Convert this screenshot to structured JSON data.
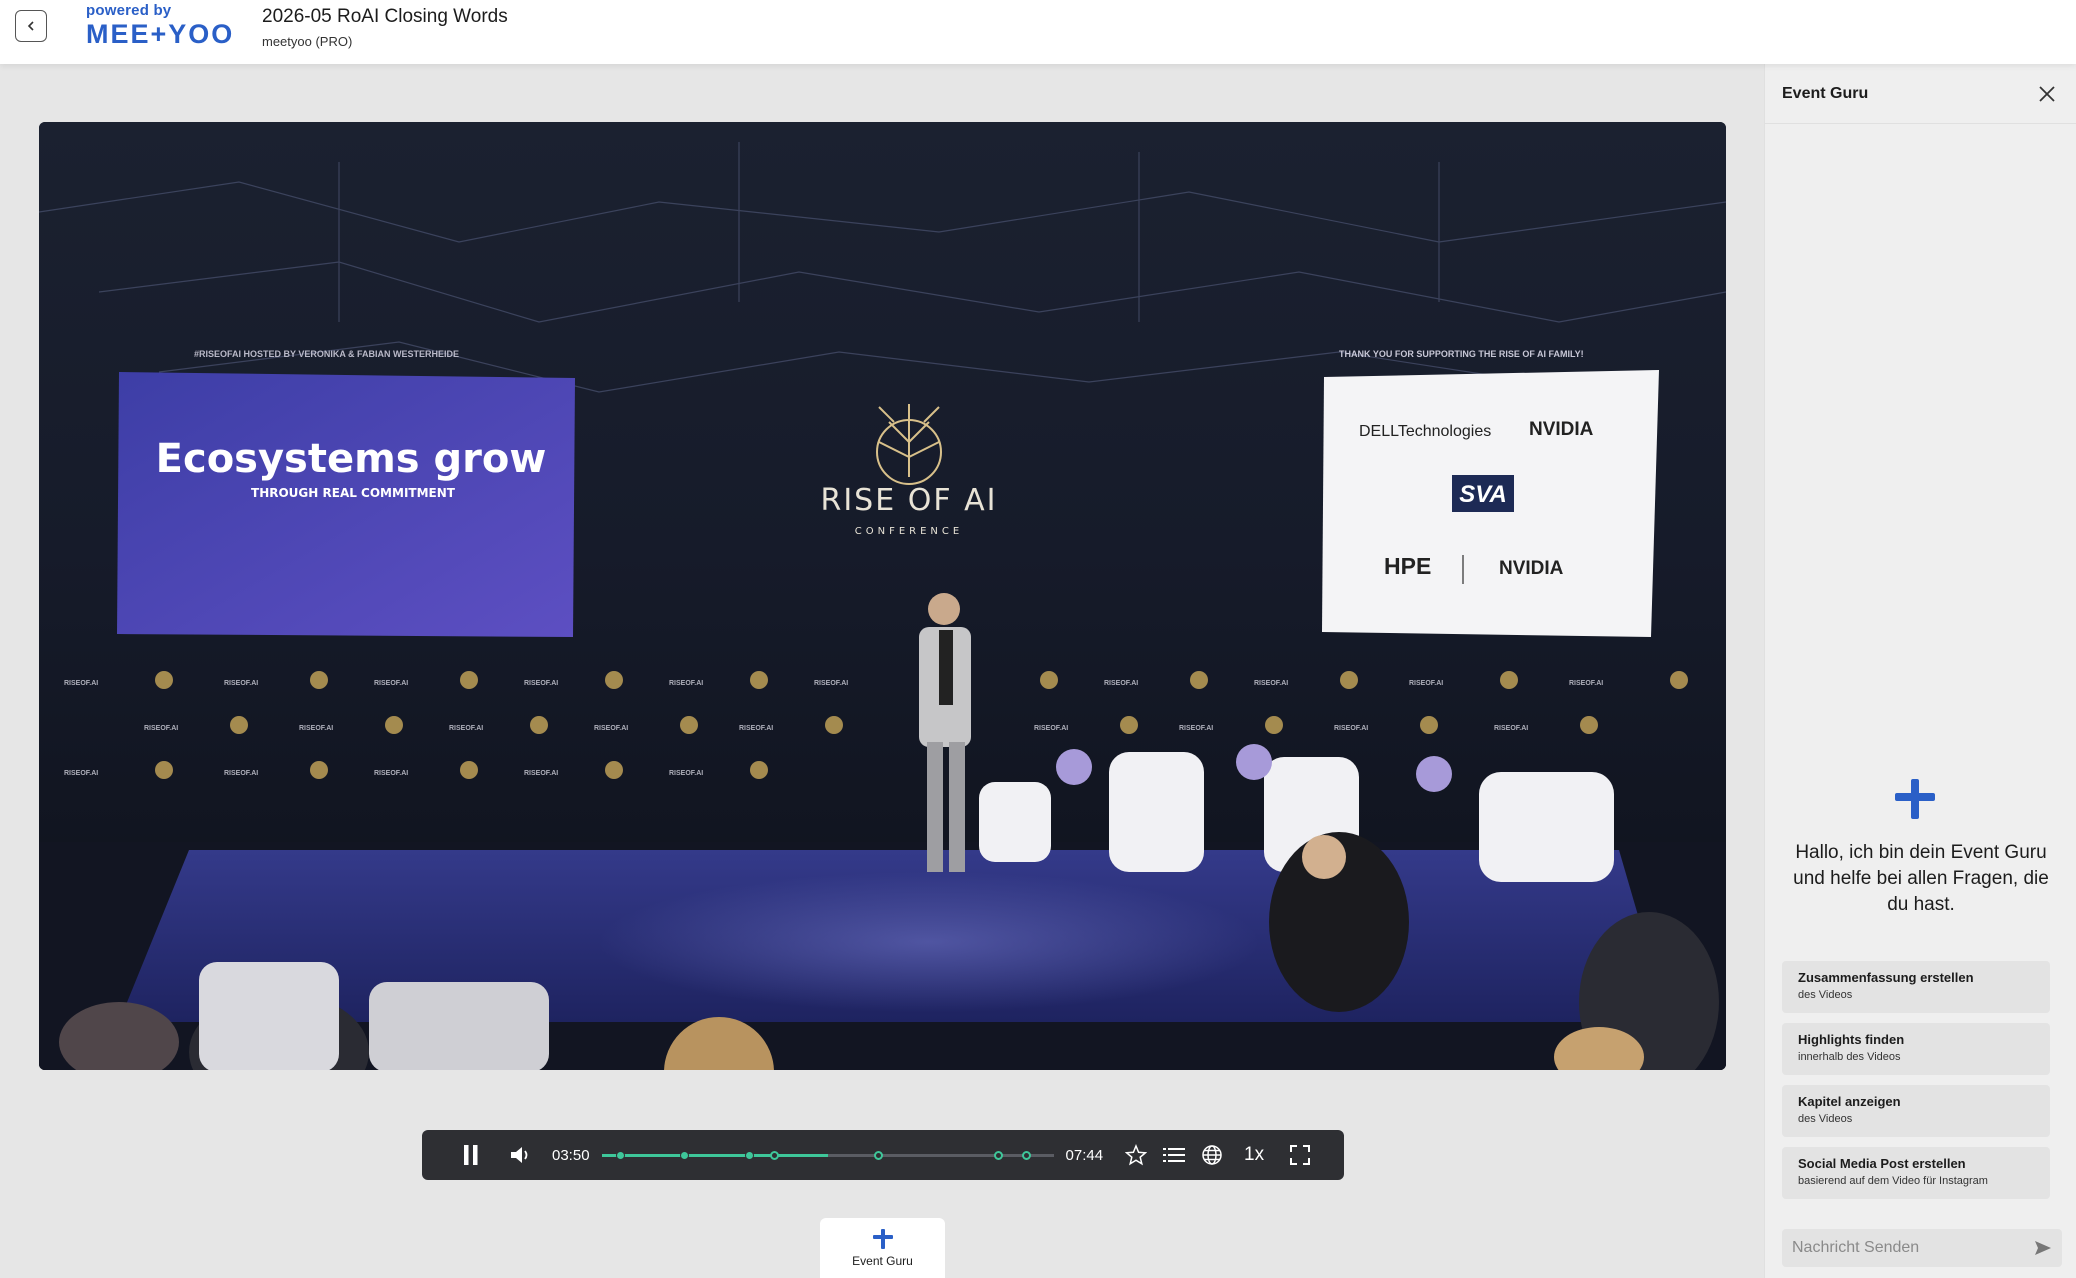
{
  "header": {
    "back_label": "‹",
    "powered_by": "powered by",
    "brand": "MEE+YOO",
    "title": "2026-05 RoAI Closing Words",
    "subtitle": "meetyoo (PRO)"
  },
  "video": {
    "screen_left_hosted": "#RISEOFAI HOSTED BY VERONIKA & FABIAN WESTERHEIDE",
    "screen_left_headline": "Ecosystems grow",
    "screen_left_sub": "THROUGH REAL COMMITMENT",
    "center_logo_title": "RISE OF AI",
    "center_logo_sub": "CONFERENCE",
    "screen_right_thanks": "THANK YOU FOR SUPPORTING THE RISE OF AI FAMILY!",
    "sponsors": [
      "DELLTechnologies",
      "NVIDIA",
      "SVA",
      "HPE",
      "NVIDIA"
    ],
    "backdrop_text": "RISEOF.AI"
  },
  "player": {
    "current_time": "03:50",
    "duration": "07:44",
    "progress": 0.5,
    "speed": "1x",
    "icons": [
      "pause-icon",
      "volume-icon",
      "star-icon",
      "chapters-icon",
      "language-icon",
      "fullscreen-icon"
    ]
  },
  "event_guru_tab": {
    "label": "Event Guru"
  },
  "panel": {
    "title": "Event Guru",
    "greeting": "Hallo, ich bin dein Event Guru und helfe bei allen Fragen, die du hast.",
    "suggestions": [
      {
        "title": "Zusammenfassung erstellen",
        "sub": "des Videos"
      },
      {
        "title": "Highlights finden",
        "sub": "innerhalb des Videos"
      },
      {
        "title": "Kapitel anzeigen",
        "sub": "des Videos"
      },
      {
        "title": "Social Media Post erstellen",
        "sub": "basierend auf dem Video für Instagram"
      }
    ],
    "message_placeholder": "Nachricht Senden"
  },
  "colors": {
    "brand_blue": "#2a5fc7",
    "accent_green": "#3ec79a",
    "control_bg": "#2e2f33"
  }
}
